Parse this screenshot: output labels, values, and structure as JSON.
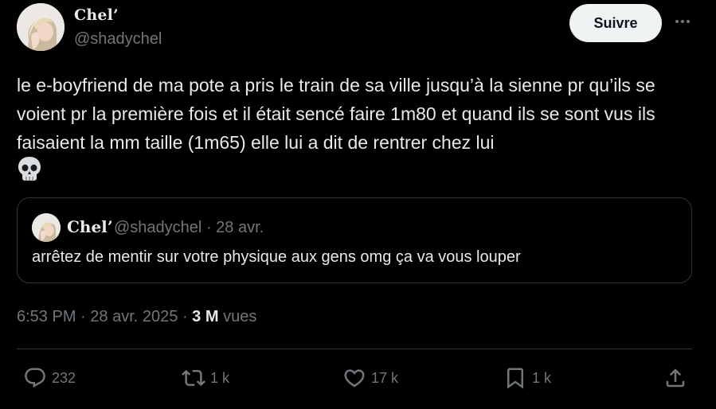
{
  "author": {
    "name": "Chel’",
    "handle": "@shadychel"
  },
  "follow_button_label": "Suivre",
  "more_icon": "more-horizontal-icon",
  "tweet_text": "le e-boyfriend de ma pote a pris le train de sa ville jusqu’à la sienne pr qu’ils se voient pr la première fois et il était sencé faire 1m80 et quand ils se sont vus ils faisaient la mm taille (1m65) elle lui a dit de rentrer chez lui",
  "emoji": "skull",
  "quoted_tweet": {
    "name": "Chel’",
    "handle": "@shadychel",
    "separator": "·",
    "date": "28 avr.",
    "text": "arrêtez de mentir sur votre physique aux gens omg ça va vous louper"
  },
  "meta": {
    "time": "6:53 PM",
    "separator": "·",
    "date": "28 avr. 2025",
    "views_count": "3 M",
    "views_label": "vues"
  },
  "actions": {
    "reply": {
      "icon": "reply-icon",
      "count": "232"
    },
    "retweet": {
      "icon": "retweet-icon",
      "count": "1 k"
    },
    "like": {
      "icon": "heart-icon",
      "count": "17 k"
    },
    "bookmark": {
      "icon": "bookmark-icon",
      "count": "1 k"
    },
    "share": {
      "icon": "share-icon"
    }
  },
  "colors": {
    "background": "#000000",
    "text_primary": "#e7e9ea",
    "text_secondary": "#71767b",
    "border": "#2f3336",
    "follow_button_bg": "#eff3f4",
    "follow_button_text": "#0f1419"
  }
}
